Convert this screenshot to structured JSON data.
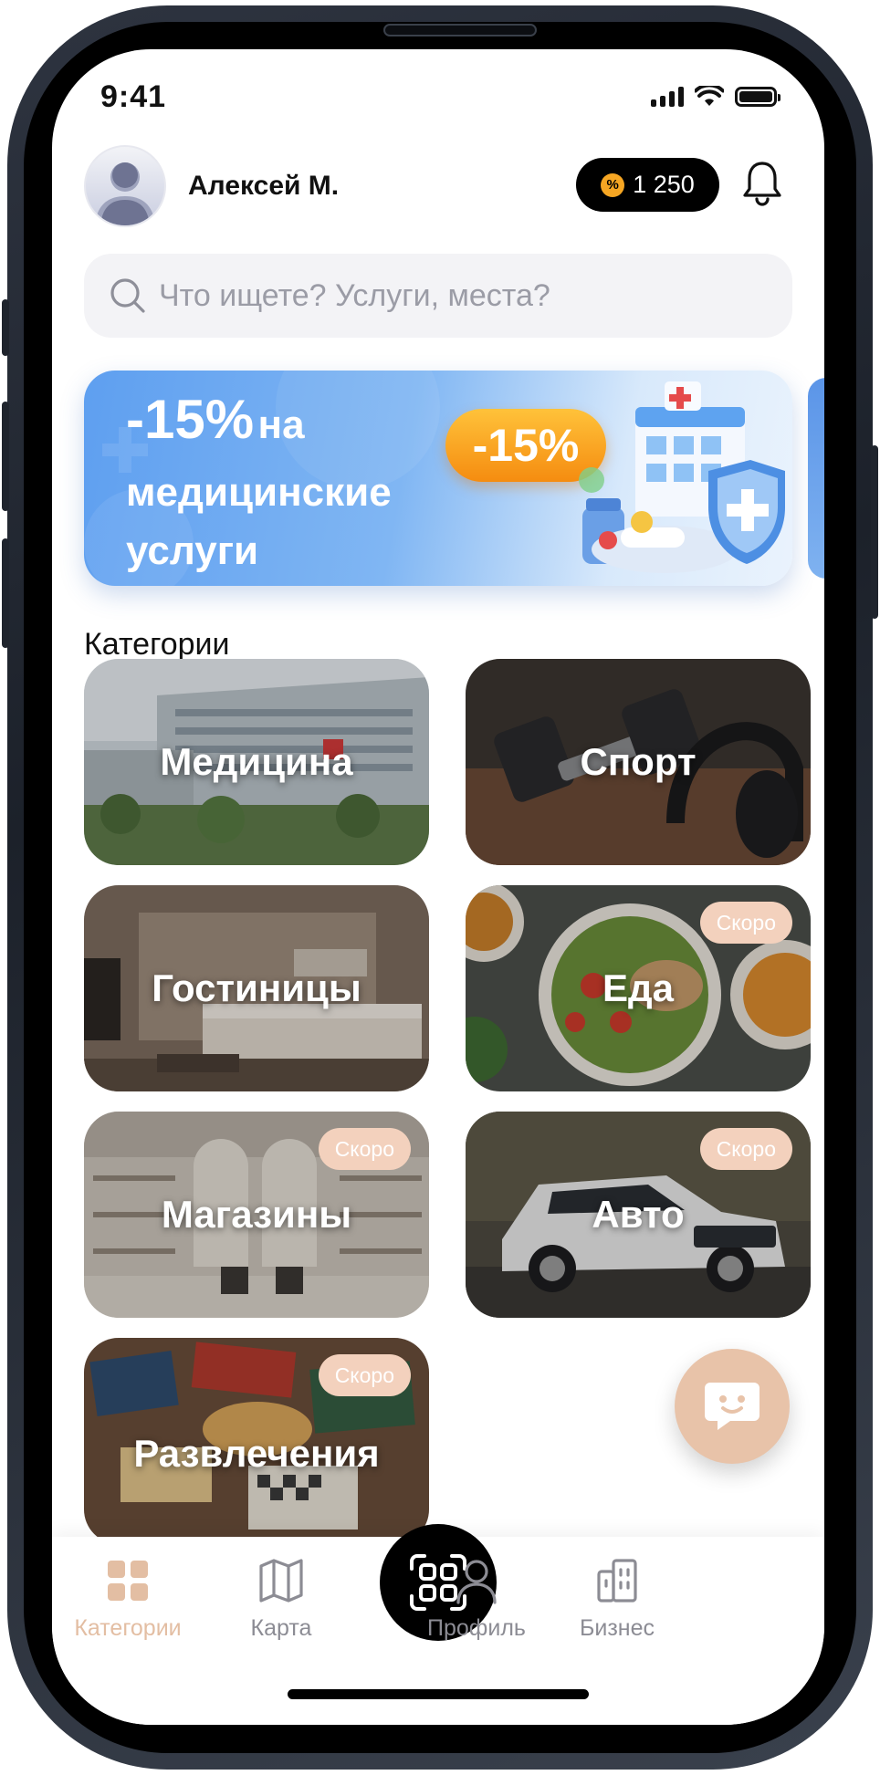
{
  "status": {
    "time": "9:41"
  },
  "header": {
    "user_name": "Алексей М.",
    "points": "1 250",
    "coin_symbol": "%"
  },
  "search": {
    "placeholder": "Что ищете? Услуги, места?"
  },
  "banner": {
    "headline_big": "-15%",
    "headline_small": "на",
    "line2": "медицинские",
    "line3": "услуги",
    "badge": "-15%"
  },
  "categories_title": "Категории",
  "categories": [
    {
      "label": "Медицина",
      "soon": ""
    },
    {
      "label": "Спорт",
      "soon": ""
    },
    {
      "label": "Гостиницы",
      "soon": ""
    },
    {
      "label": "Еда",
      "soon": "Скоро"
    },
    {
      "label": "Магазины",
      "soon": "Скоро"
    },
    {
      "label": "Авто",
      "soon": "Скоро"
    },
    {
      "label": "Развлечения",
      "soon": "Скоро"
    }
  ],
  "tabs": [
    {
      "label": "Категории",
      "icon": "grid-icon",
      "active": true
    },
    {
      "label": "Карта",
      "icon": "map-icon",
      "active": false
    },
    {
      "label": "",
      "icon": "qr-scan-icon",
      "active": false
    },
    {
      "label": "Профиль",
      "icon": "user-icon",
      "active": false
    },
    {
      "label": "Бизнес",
      "icon": "building-icon",
      "active": false
    }
  ],
  "colors": {
    "accent": "#e3bea3",
    "soon_badge": "#f3d1bd",
    "pill_bg": "#000000",
    "coin": "#f6a623",
    "banner_blue": "#5e9ff0",
    "badge_orange": "#f58c10"
  }
}
